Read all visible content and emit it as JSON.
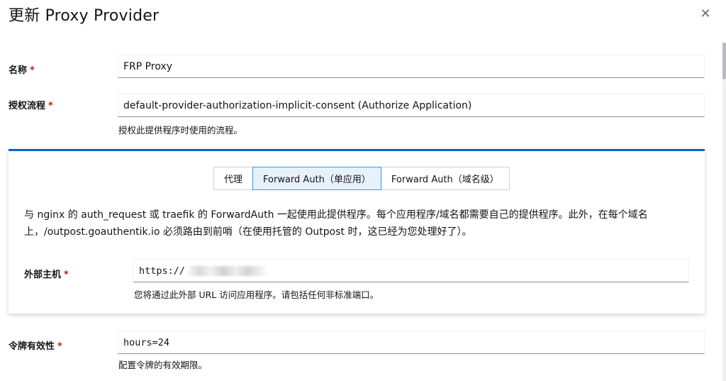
{
  "modal": {
    "title": "更新 Proxy Provider",
    "close_icon": "close-icon"
  },
  "form": {
    "name": {
      "label": "名称",
      "required_mark": "*",
      "value": "FRP Proxy"
    },
    "auth_flow": {
      "label": "授权流程",
      "required_mark": "*",
      "value": "default-provider-authorization-implicit-consent (Authorize Application)",
      "helper": "授权此提供程序时使用的流程。"
    },
    "mode_tabs": [
      {
        "label": "代理",
        "active": false
      },
      {
        "label": "Forward Auth（单应用）",
        "active": true
      },
      {
        "label": "Forward Auth（域名级）",
        "active": false
      }
    ],
    "mode_description": "与 nginx 的 auth_request 或 traefik 的 ForwardAuth 一起使用此提供程序。每个应用程序/域名都需要自己的提供程序。此外，在每个域名上，/outpost.goauthentik.io 必须路由到前哨（在使用托管的 Outpost 时，这已经为您处理好了）。",
    "external_host": {
      "label": "外部主机",
      "required_mark": "*",
      "value": "https://",
      "helper": "您将通过此外部 URL 访问应用程序。请包括任何非标准端口。"
    },
    "token_validity": {
      "label": "令牌有效性",
      "required_mark": "*",
      "value": "hours=24",
      "helper": "配置令牌的有效期限。"
    }
  },
  "colors": {
    "accent": "#0066cc",
    "required": "#c9190b",
    "active_tab_bg": "#e7f1fa",
    "active_tab_border": "#2b9af3"
  }
}
